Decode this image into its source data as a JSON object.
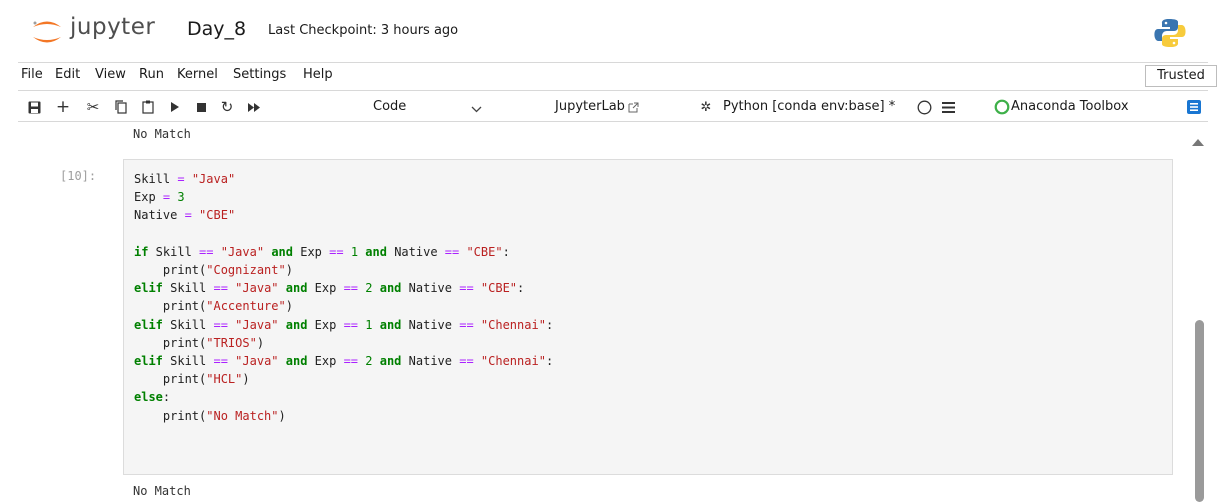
{
  "header": {
    "logo_text": "jupyter",
    "notebook_title": "Day_8",
    "checkpoint": "Last Checkpoint: 3 hours ago"
  },
  "menu": {
    "items": [
      "File",
      "Edit",
      "View",
      "Run",
      "Kernel",
      "Settings",
      "Help"
    ],
    "trusted": "Trusted"
  },
  "toolbar": {
    "cell_type": "Code",
    "jupyterlab_link": "JupyterLab",
    "kernel": "Python [conda env:base] *",
    "anaconda": "Anaconda Toolbox",
    "icons": [
      "save-icon",
      "add-cell-icon",
      "cut-icon",
      "copy-icon",
      "paste-icon",
      "run-icon",
      "stop-icon",
      "restart-icon",
      "run-all-icon",
      "chevron-down-icon",
      "external-link-icon",
      "debug-icon",
      "kernel-idle-icon",
      "menu-icon",
      "anaconda-icon",
      "property-inspector-icon"
    ]
  },
  "notebook": {
    "previous_output": "No Match",
    "cell": {
      "prompt": "[10]:",
      "lines": [
        "Skill = \"Java\"",
        "Exp = 3",
        "Native = \"CBE\"",
        "",
        "if Skill == \"Java\" and Exp == 1 and Native == \"CBE\":",
        "    print(\"Cognizant\")",
        "elif Skill == \"Java\" and Exp == 2 and Native == \"CBE\":",
        "    print(\"Accenture\")",
        "elif Skill == \"Java\" and Exp == 1 and Native == \"Chennai\":",
        "    print(\"TRIOS\")",
        "elif Skill == \"Java\" and Exp == 2 and Native == \"Chennai\":",
        "    print(\"HCL\")",
        "else:",
        "    print(\"No Match\")"
      ],
      "output": "No Match"
    }
  },
  "colors": {
    "keyword": "#008000",
    "string": "#ba2121",
    "operator": "#aa22ff",
    "accent": "#f37726"
  }
}
